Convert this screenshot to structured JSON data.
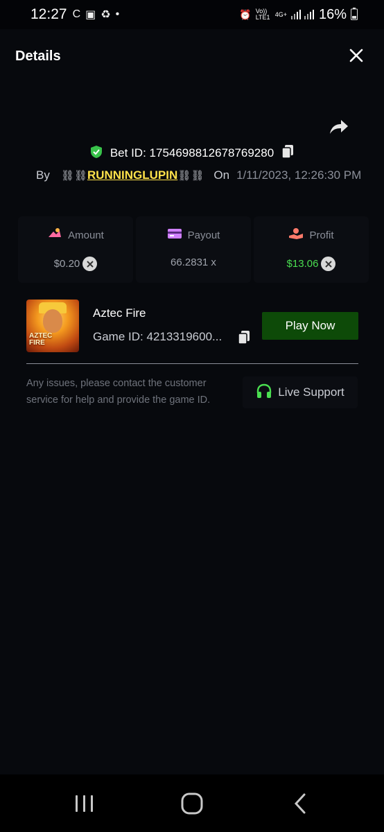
{
  "status_bar": {
    "time": "12:27",
    "battery": "16%",
    "network": "4G+",
    "lte_label": "Vo)) LTE1"
  },
  "header": {
    "title": "Details"
  },
  "bet": {
    "id_label": "Bet ID:",
    "id_value": "1754698812678769280",
    "by_label": "By",
    "username": "RUNNINGLUPIN",
    "on_label": "On",
    "date": "1/11/2023, 12:26:30 PM"
  },
  "stats": {
    "amount": {
      "label": "Amount",
      "value": "$0.20"
    },
    "payout": {
      "label": "Payout",
      "value": "66.2831 x"
    },
    "profit": {
      "label": "Profit",
      "value": "$13.06"
    }
  },
  "game": {
    "name": "Aztec Fire",
    "thumb_text_line1": "AZTEC",
    "thumb_text_line2": "FIRE",
    "id_label": "Game ID:",
    "id_value": "4213319600...",
    "play_label": "Play Now"
  },
  "support": {
    "help_text": "Any issues, please contact the customer service for help and provide the game ID.",
    "button_label": "Live Support"
  },
  "colors": {
    "background": "#030407",
    "panel": "#07090d",
    "username": "#ffe24a",
    "profit": "#4ade50",
    "play_button": "#0d4a08",
    "shield": "#38c24a",
    "headphones": "#4ade50"
  }
}
